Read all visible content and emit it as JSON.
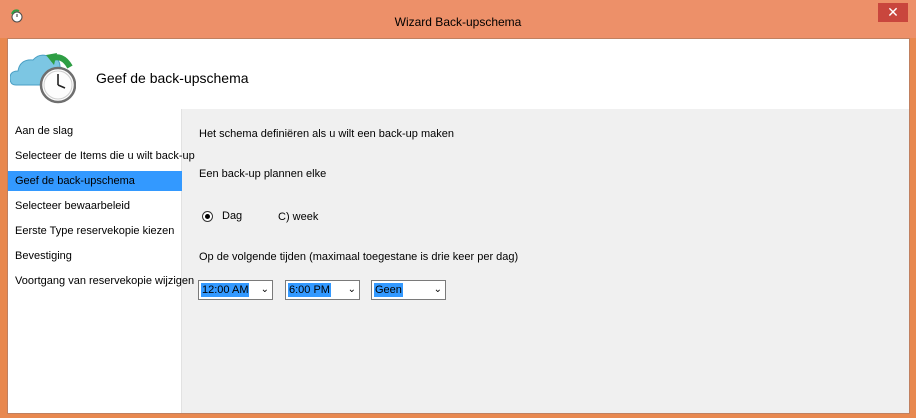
{
  "window": {
    "title": "Wizard Back-upschema",
    "close_glyph": "✕"
  },
  "header": {
    "title": "Geef de back-upschema"
  },
  "nav": {
    "items": [
      {
        "label": "Aan de slag"
      },
      {
        "label": "Selecteer de Items die u wilt back-up"
      },
      {
        "label": "Geef de back-upschema"
      },
      {
        "label": "Selecteer bewaarbeleid"
      },
      {
        "label": "Eerste Type reservekopie kiezen"
      },
      {
        "label": "Bevestiging"
      },
      {
        "label": "Voortgang van reservekopie wijzigen"
      }
    ],
    "active_index": 2
  },
  "main": {
    "intro": "Het schema definiëren als u wilt een back-up maken",
    "frequency_label": "Een back-up plannen elke",
    "options": [
      {
        "label": "Dag",
        "selected": true
      },
      {
        "label": "C) week",
        "selected": false
      }
    ],
    "times_label": "Op de volgende tijden (maximaal toegestane is drie keer per dag)",
    "time_selects": [
      {
        "value": "12:00 AM"
      },
      {
        "value": "6:00 PM"
      },
      {
        "value": "Geen"
      }
    ]
  },
  "colors": {
    "titlebar": "#ed9069",
    "accent": "#3399ff",
    "close": "#c9463d"
  },
  "icons": {
    "app": "backup-clock-icon",
    "header": "cloud-clock-icon",
    "dropdown": "chevron-down-icon"
  }
}
